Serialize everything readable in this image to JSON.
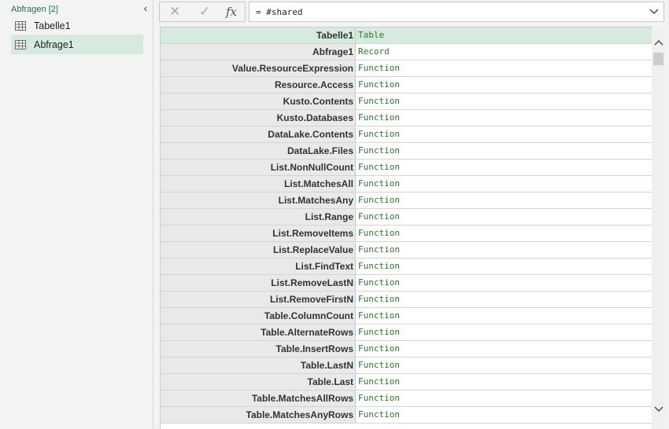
{
  "queries_pane": {
    "title": "Abfragen [2]",
    "collapse_icon": "chevron-left-icon",
    "items": [
      {
        "label": "Tabelle1",
        "icon": "table-icon",
        "selected": false
      },
      {
        "label": "Abfrage1",
        "icon": "table-icon",
        "selected": true
      }
    ]
  },
  "formula_bar": {
    "cancel_glyph": "✕",
    "confirm_glyph": "✓",
    "fx_label": "fx",
    "formula": "= #shared",
    "expand_icon": "chevron-down-icon"
  },
  "colors": {
    "accent_green": "#217346",
    "highlight": "#d6ebdd",
    "value_text": "#2a7a2a"
  },
  "records": [
    {
      "name": "Tabelle1",
      "value": "Table"
    },
    {
      "name": "Abfrage1",
      "value": "Record"
    },
    {
      "name": "Value.ResourceExpression",
      "value": "Function"
    },
    {
      "name": "Resource.Access",
      "value": "Function"
    },
    {
      "name": "Kusto.Contents",
      "value": "Function"
    },
    {
      "name": "Kusto.Databases",
      "value": "Function"
    },
    {
      "name": "DataLake.Contents",
      "value": "Function"
    },
    {
      "name": "DataLake.Files",
      "value": "Function"
    },
    {
      "name": "List.NonNullCount",
      "value": "Function"
    },
    {
      "name": "List.MatchesAll",
      "value": "Function"
    },
    {
      "name": "List.MatchesAny",
      "value": "Function"
    },
    {
      "name": "List.Range",
      "value": "Function"
    },
    {
      "name": "List.RemoveItems",
      "value": "Function"
    },
    {
      "name": "List.ReplaceValue",
      "value": "Function"
    },
    {
      "name": "List.FindText",
      "value": "Function"
    },
    {
      "name": "List.RemoveLastN",
      "value": "Function"
    },
    {
      "name": "List.RemoveFirstN",
      "value": "Function"
    },
    {
      "name": "Table.ColumnCount",
      "value": "Function"
    },
    {
      "name": "Table.AlternateRows",
      "value": "Function"
    },
    {
      "name": "Table.InsertRows",
      "value": "Function"
    },
    {
      "name": "Table.LastN",
      "value": "Function"
    },
    {
      "name": "Table.Last",
      "value": "Function"
    },
    {
      "name": "Table.MatchesAllRows",
      "value": "Function"
    },
    {
      "name": "Table.MatchesAnyRows",
      "value": "Function"
    }
  ]
}
